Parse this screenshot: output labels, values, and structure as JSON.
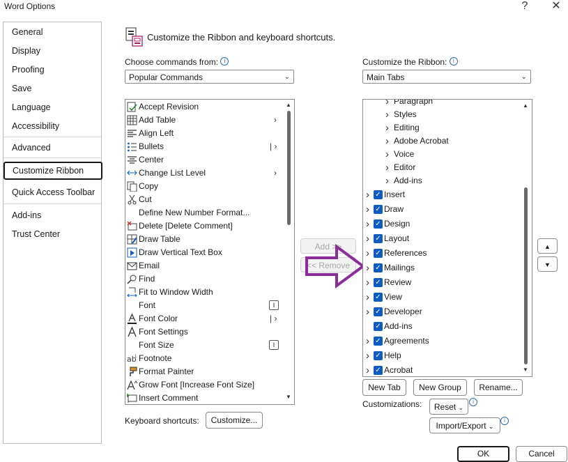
{
  "window": {
    "title": "Word Options",
    "help": "?",
    "close": "✕"
  },
  "nav": {
    "items": [
      {
        "label": "General"
      },
      {
        "label": "Display"
      },
      {
        "label": "Proofing"
      },
      {
        "label": "Save"
      },
      {
        "label": "Language"
      },
      {
        "label": "Accessibility"
      },
      {
        "label": "Advanced"
      },
      {
        "label": "Customize Ribbon"
      },
      {
        "label": "Quick Access Toolbar"
      },
      {
        "label": "Add-ins"
      },
      {
        "label": "Trust Center"
      }
    ],
    "selected": "Customize Ribbon"
  },
  "header": {
    "title": "Customize the Ribbon and keyboard shortcuts."
  },
  "left": {
    "choose_label": "Choose commands from:",
    "choose_value": "Popular Commands",
    "commands": [
      {
        "label": "Accept Revision",
        "icon": "accept-revision-icon"
      },
      {
        "label": "Add Table",
        "icon": "table-icon",
        "sub": ">"
      },
      {
        "label": "Align Left",
        "icon": "align-left-icon"
      },
      {
        "label": "Bullets",
        "icon": "bullets-icon",
        "sub": "|>"
      },
      {
        "label": "Center",
        "icon": "align-center-icon"
      },
      {
        "label": "Change List Level",
        "icon": "list-level-icon",
        "sub": ">"
      },
      {
        "label": "Copy",
        "icon": "copy-icon"
      },
      {
        "label": "Cut",
        "icon": "scissors-icon"
      },
      {
        "label": "Define New Number Format...",
        "icon": ""
      },
      {
        "label": "Delete [Delete Comment]",
        "icon": "delete-comment-icon"
      },
      {
        "label": "Draw Table",
        "icon": "draw-table-icon"
      },
      {
        "label": "Draw Vertical Text Box",
        "icon": "text-box-icon"
      },
      {
        "label": "Email",
        "icon": "email-icon"
      },
      {
        "label": "Find",
        "icon": "find-icon"
      },
      {
        "label": "Fit to Window Width",
        "icon": "fit-width-icon"
      },
      {
        "label": "Font",
        "icon": "",
        "box": "I"
      },
      {
        "label": "Font Color",
        "icon": "font-color-icon",
        "sub": "|>"
      },
      {
        "label": "Font Settings",
        "icon": "font-settings-icon"
      },
      {
        "label": "Font Size",
        "icon": "",
        "box": "I"
      },
      {
        "label": "Footnote",
        "icon": "footnote-icon"
      },
      {
        "label": "Format Painter",
        "icon": "format-painter-icon"
      },
      {
        "label": "Grow Font [Increase Font Size]",
        "icon": "grow-font-icon"
      },
      {
        "label": "Insert Comment",
        "icon": "insert-comment-icon"
      }
    ],
    "keyboard_label": "Keyboard shortcuts:",
    "customize_button": "Customize..."
  },
  "middle": {
    "add_button": "Add >>",
    "remove_button": "<< Remove"
  },
  "right": {
    "customize_label": "Customize the Ribbon:",
    "customize_value": "Main Tabs",
    "tree": [
      {
        "label": "Paragraph",
        "level": 2,
        "checkbox": false,
        "expander": true
      },
      {
        "label": "Styles",
        "level": 2,
        "checkbox": false,
        "expander": true
      },
      {
        "label": "Editing",
        "level": 2,
        "checkbox": false,
        "expander": true
      },
      {
        "label": "Adobe Acrobat",
        "level": 2,
        "checkbox": false,
        "expander": true
      },
      {
        "label": "Voice",
        "level": 2,
        "checkbox": false,
        "expander": true
      },
      {
        "label": "Editor",
        "level": 2,
        "checkbox": false,
        "expander": true
      },
      {
        "label": "Add-ins",
        "level": 2,
        "checkbox": false,
        "expander": true
      },
      {
        "label": "Insert",
        "level": 1,
        "checkbox": true,
        "expander": true
      },
      {
        "label": "Draw",
        "level": 1,
        "checkbox": true,
        "expander": true
      },
      {
        "label": "Design",
        "level": 1,
        "checkbox": true,
        "expander": true
      },
      {
        "label": "Layout",
        "level": 1,
        "checkbox": true,
        "expander": true
      },
      {
        "label": "References",
        "level": 1,
        "checkbox": true,
        "expander": true
      },
      {
        "label": "Mailings",
        "level": 1,
        "checkbox": true,
        "expander": true
      },
      {
        "label": "Review",
        "level": 1,
        "checkbox": true,
        "expander": true
      },
      {
        "label": "View",
        "level": 1,
        "checkbox": true,
        "expander": true
      },
      {
        "label": "Developer",
        "level": 1,
        "checkbox": true,
        "expander": true
      },
      {
        "label": "Add-ins",
        "level": 1,
        "checkbox": true,
        "expander": false
      },
      {
        "label": "Agreements",
        "level": 1,
        "checkbox": true,
        "expander": true
      },
      {
        "label": "Help",
        "level": 1,
        "checkbox": true,
        "expander": true
      },
      {
        "label": "Acrobat",
        "level": 1,
        "checkbox": true,
        "expander": true
      }
    ],
    "new_tab": "New Tab",
    "new_group": "New Group",
    "rename": "Rename...",
    "customizations_label": "Customizations:",
    "reset": "Reset",
    "import_export": "Import/Export"
  },
  "footer": {
    "ok": "OK",
    "cancel": "Cancel"
  },
  "colors": {
    "accent": "#0f5cc0",
    "annotation_arrow": "#8b2c9a"
  }
}
